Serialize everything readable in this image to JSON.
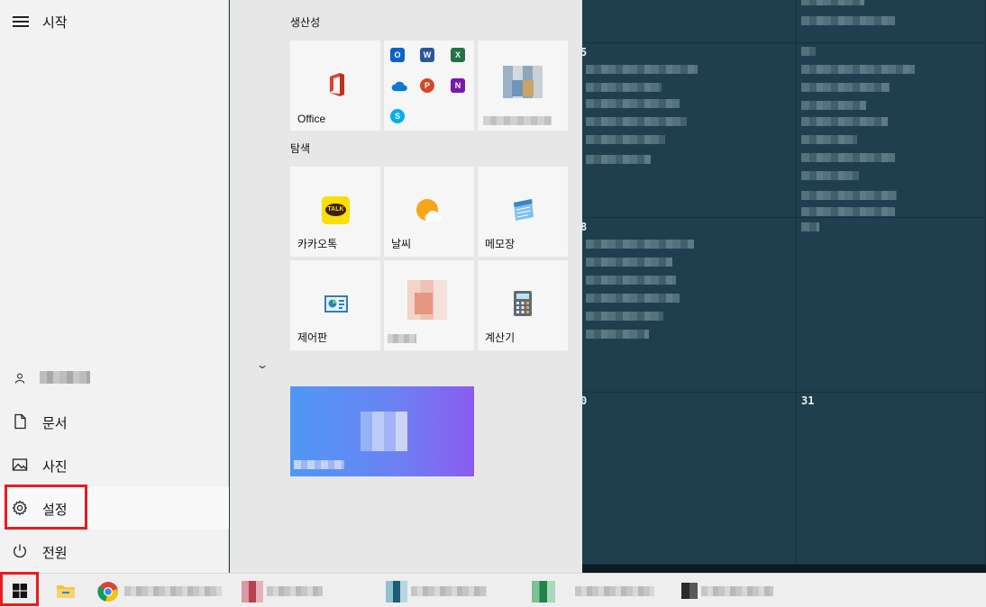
{
  "start": {
    "title": "시작"
  },
  "sidebar": {
    "items": [
      {
        "label": "문서",
        "icon": "document-icon"
      },
      {
        "label": "사진",
        "icon": "photo-icon"
      },
      {
        "label": "설정",
        "icon": "gear-icon"
      },
      {
        "label": "전원",
        "icon": "power-icon"
      }
    ]
  },
  "groups": [
    {
      "title": "생산성"
    },
    {
      "title": "탐색"
    }
  ],
  "tiles": {
    "office": "Office",
    "kakao": "카카오톡",
    "weather": "날씨",
    "memo": "메모장",
    "control_panel": "제어판",
    "calculator": "계산기"
  },
  "office_apps": [
    {
      "icon": "outlook-icon",
      "letter": "O",
      "color": "#0a64c8"
    },
    {
      "icon": "word-icon",
      "letter": "W",
      "color": "#2b579a"
    },
    {
      "icon": "excel-icon",
      "letter": "X",
      "color": "#217346"
    },
    {
      "icon": "onedrive-icon",
      "letter": "",
      "color": "#0f78d4"
    },
    {
      "icon": "powerpoint-icon",
      "letter": "P",
      "color": "#d24726"
    },
    {
      "icon": "onenote-icon",
      "letter": "N",
      "color": "#7719aa"
    },
    {
      "icon": "skype-icon",
      "letter": "S",
      "color": "#00aff0"
    }
  ],
  "calendar": {
    "day_31": "31",
    "day_5": "5",
    "day_8": "8",
    "day_0": "0"
  },
  "colors": {
    "highlight": "#e81c1c",
    "desktop": "#1f3f4e",
    "wide_tile_start": "#4f98f5",
    "wide_tile_end": "#8a5cf0"
  }
}
